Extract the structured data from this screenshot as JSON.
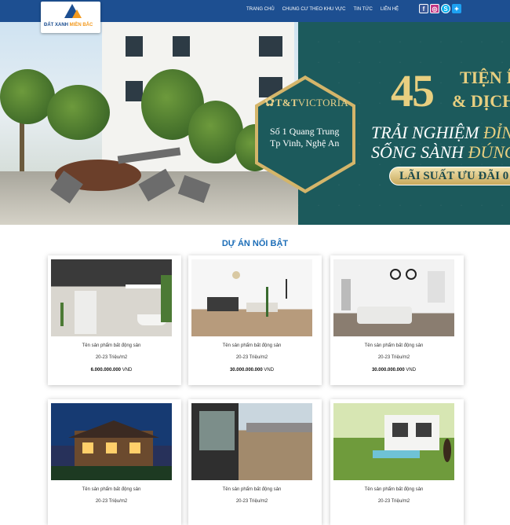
{
  "header": {
    "logo_text_main": "ĐẤT XANH",
    "logo_text_accent": "MIỀN BẮC",
    "nav": [
      "TRANG CHỦ",
      "CHUNG CƯ THEO KHU VỰC",
      "TIN TỨC",
      "LIÊN HỆ"
    ],
    "social": [
      "facebook-icon",
      "instagram-icon",
      "skype-icon",
      "twitter-icon"
    ]
  },
  "banner": {
    "brand_prefix": "T&T",
    "brand_name": "VICTORIA",
    "address_line1": "Số 1 Quang Trung",
    "address_line2": "Tp Vinh, Nghệ An",
    "number": "45",
    "amenities_1": "TIỆN Í",
    "amenities_2": "& DỊCH",
    "headline1_a": "TRẢI NGHIỆM ",
    "headline1_b": "ĐỈNH",
    "headline2_a": "SỐNG SÀNH ",
    "headline2_b": "ĐÚNG",
    "loan": "LÃI SUẤT ƯU ĐÃI 0",
    "colors": {
      "panel": "#1c5a5c",
      "gold": "#e8cf80"
    }
  },
  "section": {
    "title": "DỰ ÁN NỔI BẬT"
  },
  "products": [
    {
      "name": "Tên sản phẩm bất động sản",
      "area": "20-23 Triệu/m2",
      "price": "6.000.000.000",
      "unit": "VND"
    },
    {
      "name": "Tên sản phẩm bất động sản",
      "area": "20-23 Triệu/m2",
      "price": "30.000.000.000",
      "unit": "VND"
    },
    {
      "name": "Tên sản phẩm bất động sản",
      "area": "20-23 Triệu/m2",
      "price": "30.000.000.000",
      "unit": "VND"
    },
    {
      "name": "Tên sản phẩm bất động sản",
      "area": "20-23 Triệu/m2"
    },
    {
      "name": "Tên sản phẩm bất động sản",
      "area": "20-23 Triệu/m2"
    },
    {
      "name": "Tên sản phẩm bất động sản",
      "area": "20-23 Triệu/m2"
    }
  ],
  "colors": {
    "header": "#1d4f91",
    "section_title": "#1d6eb8"
  }
}
